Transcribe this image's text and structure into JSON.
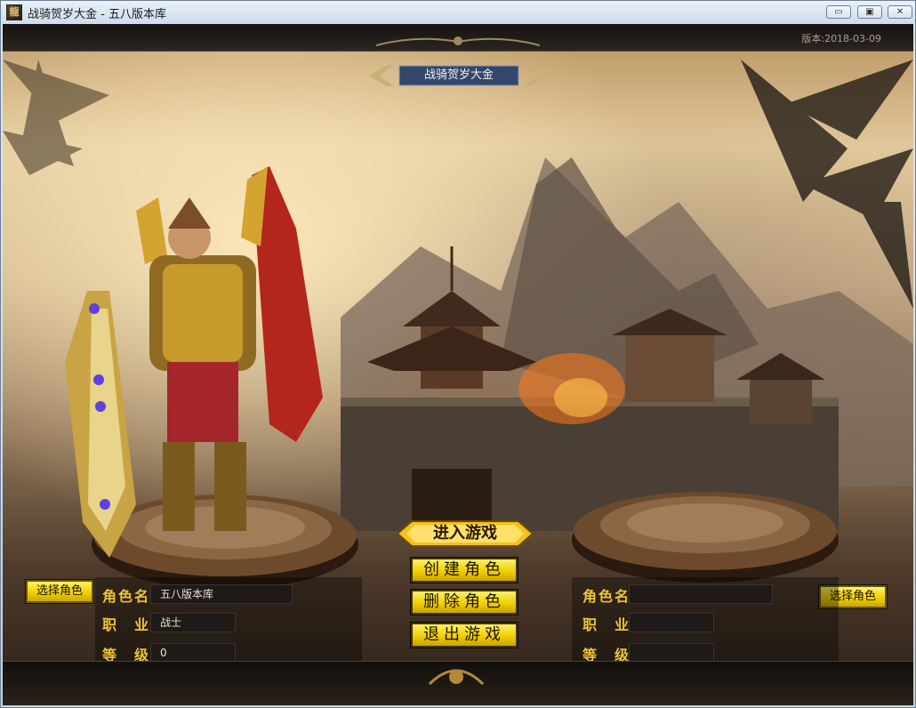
{
  "window": {
    "title": "战骑贺岁大金 - 五八版本库",
    "app_icon_glyph": "龍",
    "controls": {
      "minimize": "▭",
      "restore": "▣",
      "close": "✕"
    }
  },
  "game": {
    "version": "版本:2018-03-09",
    "banner_title": "战骑贺岁大金"
  },
  "left_slot": {
    "select_label": "选择角色",
    "name_label": "角色名",
    "name_value": "五八版本库",
    "class_label": "职　业",
    "class_value": "战士",
    "level_label": "等　级",
    "level_value": "0"
  },
  "right_slot": {
    "select_label": "选择角色",
    "name_label": "角色名",
    "name_value": "",
    "class_label": "职　业",
    "class_value": "",
    "level_label": "等　级",
    "level_value": ""
  },
  "menu": {
    "enter_game": "进入游戏",
    "create_role": "创建角色",
    "delete_role": "删除角色",
    "exit_game": "退出游戏"
  },
  "colors": {
    "gold_text": "#f0c432",
    "button_yellow": "#f1d000",
    "frame_dark": "#1a1512"
  }
}
